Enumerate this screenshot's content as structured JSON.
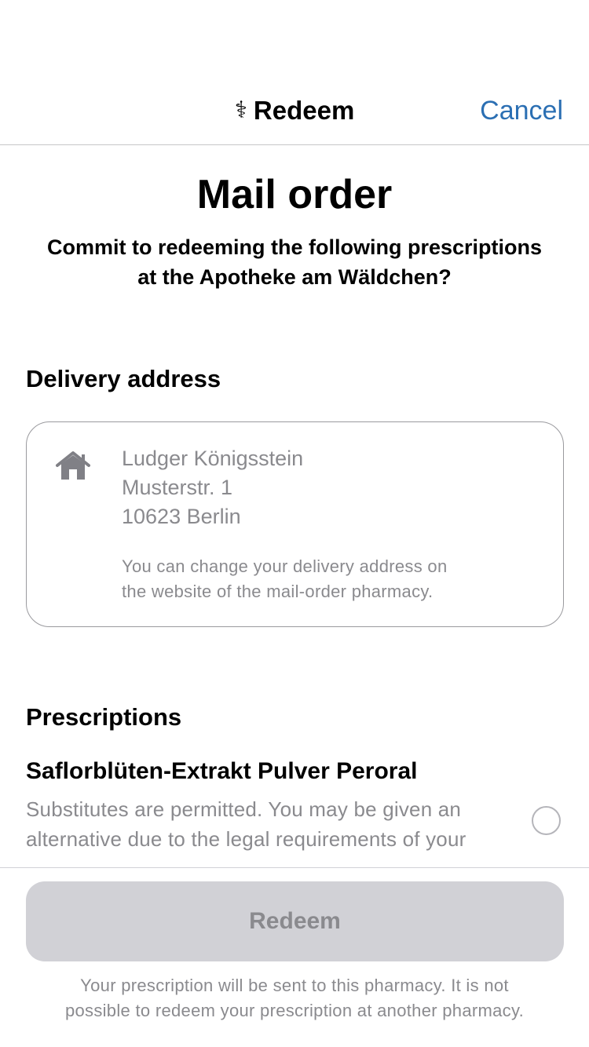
{
  "nav": {
    "staff_glyph": "⚕",
    "title": "Redeem",
    "cancel_label": "Cancel"
  },
  "header": {
    "title": "Mail order",
    "subtitle_line1": "Commit to redeeming the following prescriptions",
    "subtitle_line2": "at the Apotheke am Wäldchen?"
  },
  "delivery": {
    "heading": "Delivery address",
    "icon": "house-icon",
    "name": "Ludger Königsstein",
    "street": "Musterstr. 1",
    "city": "10623 Berlin",
    "note_line1": "You can change your delivery address on",
    "note_line2": "the website of the mail-order pharmacy."
  },
  "prescriptions": {
    "heading": "Prescriptions",
    "items": [
      {
        "name": "Saflorblüten-Extrakt Pulver Peroral",
        "desc_line1": "Substitutes are permitted. You may be given an",
        "desc_line2": "alternative due to the legal requirements of your",
        "selected": false
      }
    ]
  },
  "footer": {
    "redeem_label": "Redeem",
    "note_line1": "Your prescription will be sent to this pharmacy. It is not",
    "note_line2": "possible to redeem your prescription at another pharmacy."
  },
  "colors": {
    "accent": "#2b6fb3",
    "secondary_text": "#8a8a8e",
    "button_disabled_bg": "#d1d1d6"
  }
}
